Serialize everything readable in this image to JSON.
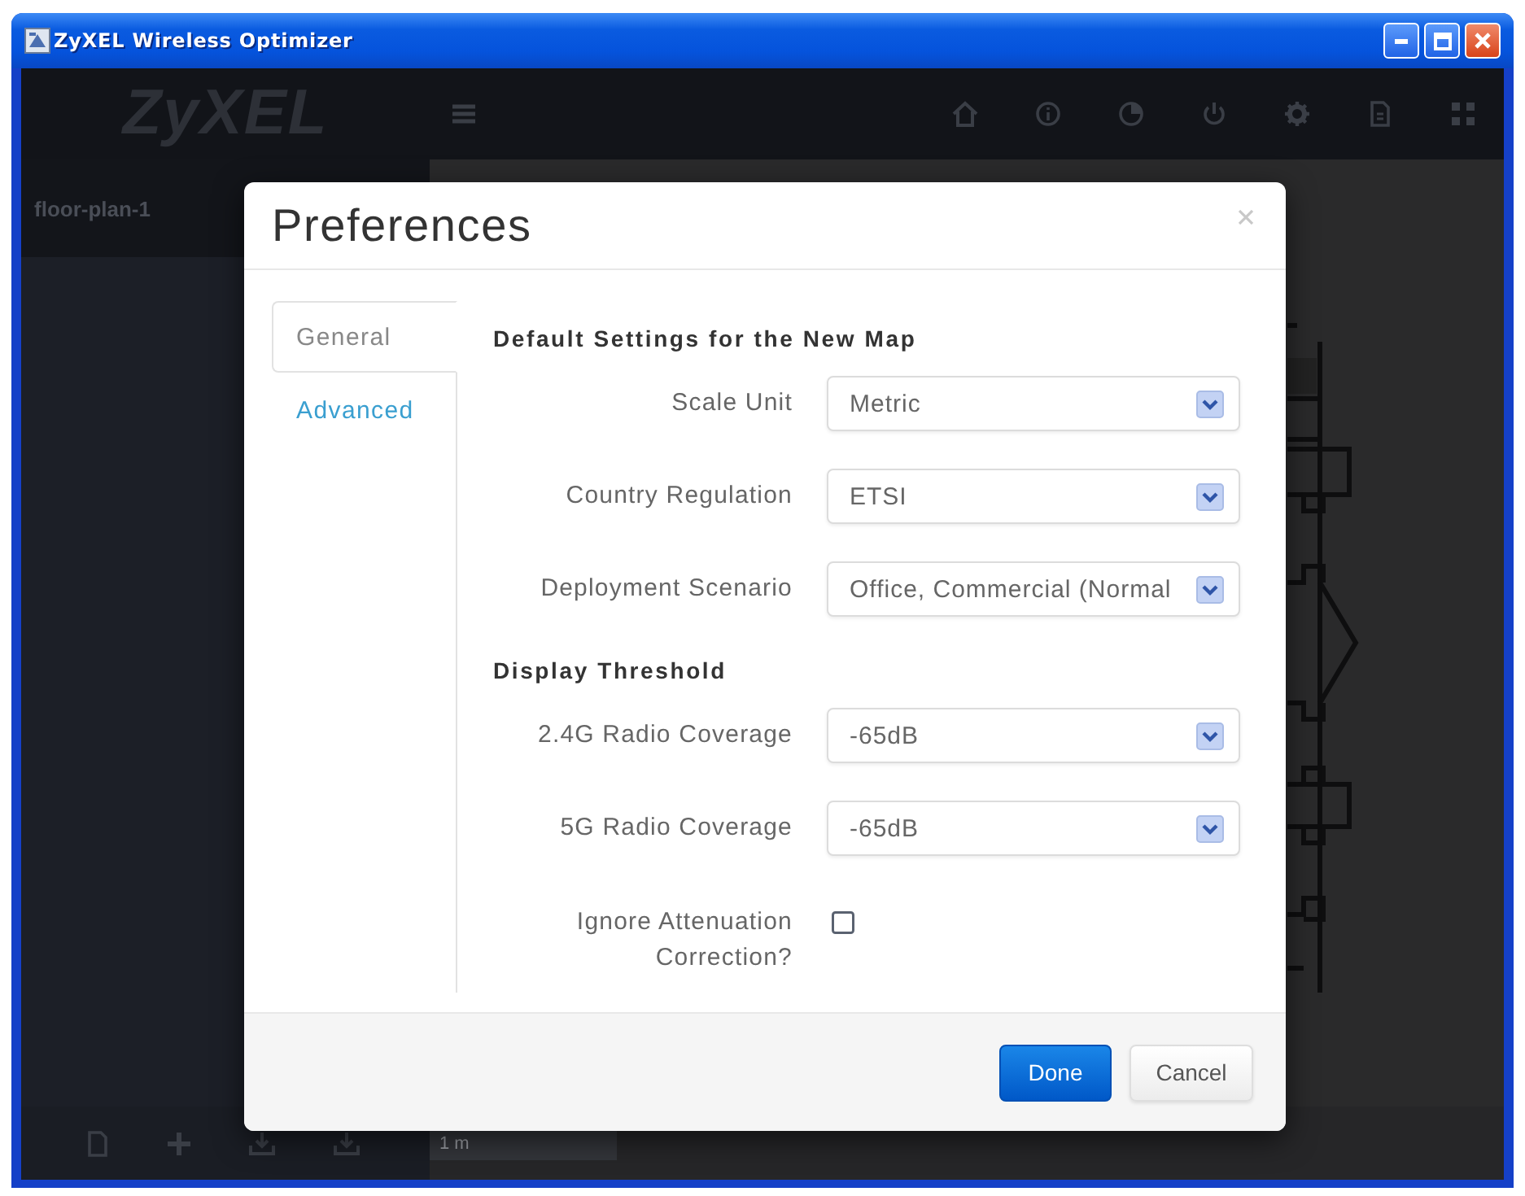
{
  "window": {
    "title": "ZyXEL Wireless Optimizer"
  },
  "app": {
    "logo": "ZyXEL",
    "sidebar": {
      "items": [
        {
          "label": "floor-plan-1",
          "selected": true
        }
      ]
    },
    "bottom_bar": {
      "scale_label": "1 m"
    }
  },
  "dialog": {
    "title": "Preferences",
    "tabs": [
      {
        "label": "General",
        "selected": true
      },
      {
        "label": "Advanced",
        "selected": false
      }
    ],
    "sections": [
      {
        "heading": "Default Settings for the New Map",
        "fields": [
          {
            "kind": "select",
            "label": "Scale Unit",
            "value": "Metric"
          },
          {
            "kind": "select",
            "label": "Country Regulation",
            "value": "ETSI"
          },
          {
            "kind": "select",
            "label": "Deployment Scenario",
            "value": "Office, Commercial (Normal"
          }
        ]
      },
      {
        "heading": "Display Threshold",
        "fields": [
          {
            "kind": "select",
            "label": "2.4G Radio Coverage",
            "value": "-65dB"
          },
          {
            "kind": "select",
            "label": "5G Radio Coverage",
            "value": "-65dB"
          },
          {
            "kind": "checkbox",
            "label": "Ignore Attenuation Correction?",
            "checked": false
          }
        ]
      }
    ],
    "buttons": [
      {
        "label": "Done",
        "kind": "primary"
      },
      {
        "label": "Cancel",
        "kind": "default"
      }
    ]
  }
}
